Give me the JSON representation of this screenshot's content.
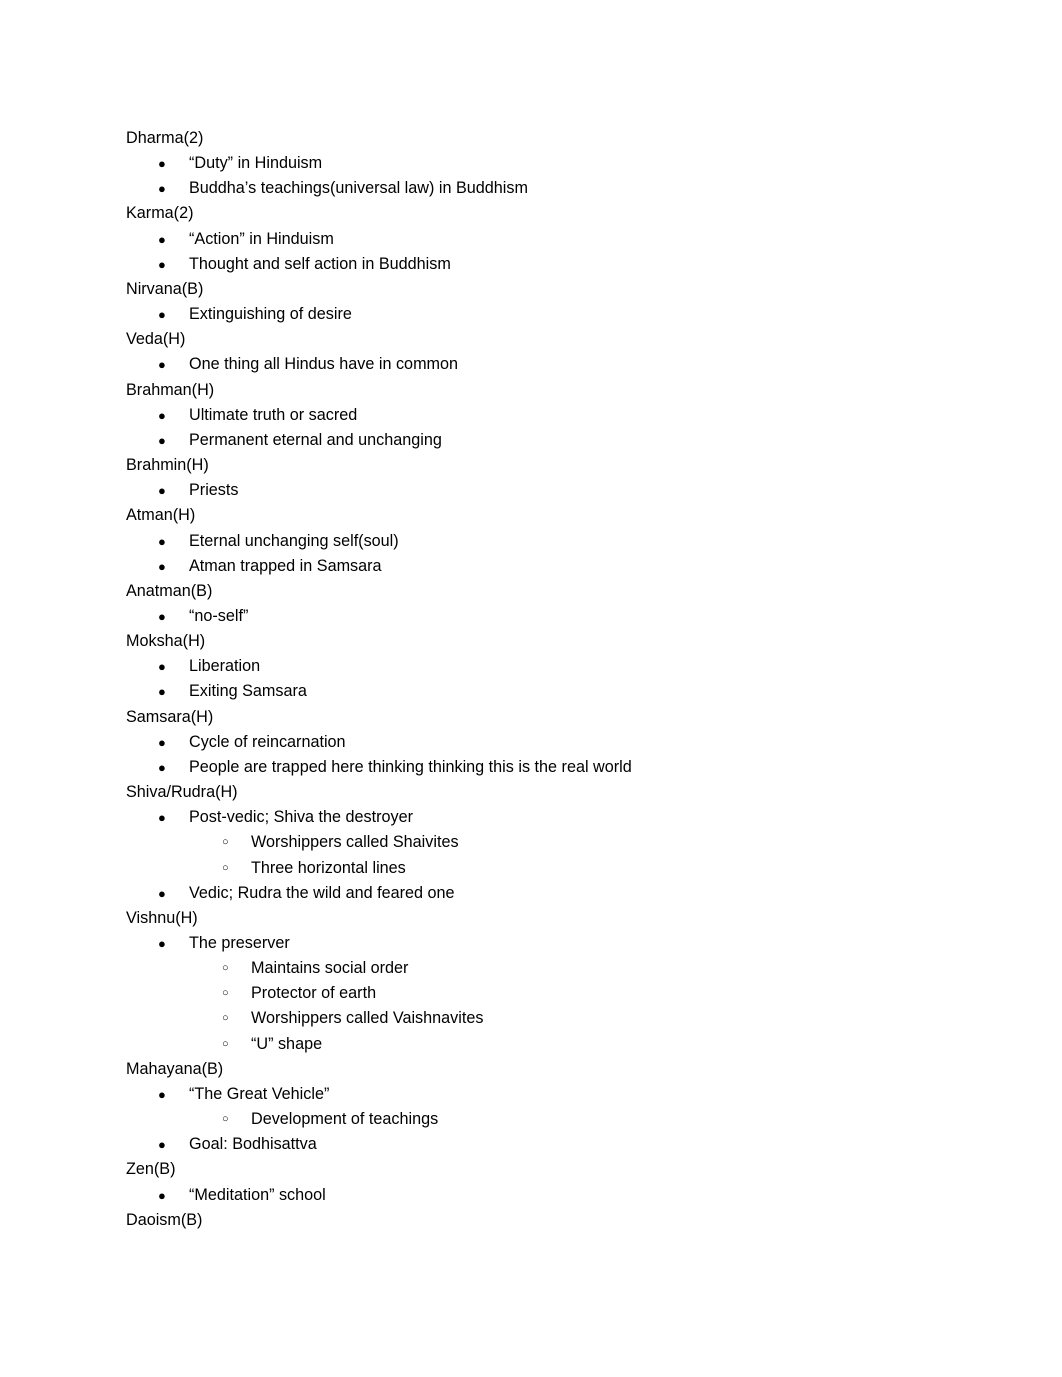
{
  "document": {
    "bullet_glyph_level1": "●",
    "bullet_glyph_level2": "○",
    "text_color": "#000000",
    "background_color": "#ffffff",
    "entries": [
      {
        "term": "Dharma(2)",
        "points": [
          {
            "text": "“Duty” in Hinduism",
            "sub": []
          },
          {
            "text": "Buddha’s teachings(universal law) in Buddhism",
            "sub": []
          }
        ]
      },
      {
        "term": "Karma(2)",
        "points": [
          {
            "text": "“Action” in Hinduism",
            "sub": []
          },
          {
            "text": "Thought and self action in Buddhism",
            "sub": []
          }
        ]
      },
      {
        "term": "Nirvana(B)",
        "points": [
          {
            "text": "Extinguishing of desire",
            "sub": []
          }
        ]
      },
      {
        "term": "Veda(H)",
        "points": [
          {
            "text": "One thing all Hindus have in common",
            "sub": []
          }
        ]
      },
      {
        "term": "Brahman(H)",
        "points": [
          {
            "text": "Ultimate truth or sacred",
            "sub": []
          },
          {
            "text": "Permanent eternal and unchanging",
            "sub": []
          }
        ]
      },
      {
        "term": "Brahmin(H)",
        "points": [
          {
            "text": "Priests",
            "sub": []
          }
        ]
      },
      {
        "term": "Atman(H)",
        "points": [
          {
            "text": "Eternal unchanging self(soul)",
            "sub": []
          },
          {
            "text": "Atman trapped in Samsara",
            "sub": []
          }
        ]
      },
      {
        "term": "Anatman(B)",
        "points": [
          {
            "text": "“no-self”",
            "sub": []
          }
        ]
      },
      {
        "term": "Moksha(H)",
        "points": [
          {
            "text": "Liberation",
            "sub": []
          },
          {
            "text": "Exiting Samsara",
            "sub": []
          }
        ]
      },
      {
        "term": "Samsara(H)",
        "points": [
          {
            "text": "Cycle of reincarnation",
            "sub": []
          },
          {
            "text": "People are trapped here thinking thinking this is the real world",
            "sub": []
          }
        ]
      },
      {
        "term": "Shiva/Rudra(H)",
        "points": [
          {
            "text": "Post-vedic; Shiva the destroyer",
            "sub": [
              {
                "text": "Worshippers called Shaivites"
              },
              {
                "text": "Three horizontal lines"
              }
            ]
          },
          {
            "text": "Vedic; Rudra the wild and feared one",
            "sub": []
          }
        ]
      },
      {
        "term": "Vishnu(H)",
        "points": [
          {
            "text": "The preserver",
            "sub": [
              {
                "text": "Maintains social order"
              },
              {
                "text": "Protector of earth"
              },
              {
                "text": "Worshippers called Vaishnavites"
              },
              {
                "text": "“U” shape"
              }
            ]
          }
        ]
      },
      {
        "term": "Mahayana(B)",
        "points": [
          {
            "text": "“The Great Vehicle”",
            "sub": [
              {
                "text": "Development of teachings"
              }
            ]
          },
          {
            "text": "Goal: Bodhisattva",
            "sub": []
          }
        ]
      },
      {
        "term": "Zen(B)",
        "points": [
          {
            "text": "“Meditation” school",
            "sub": []
          }
        ]
      },
      {
        "term": "Daoism(B)",
        "points": []
      }
    ]
  }
}
